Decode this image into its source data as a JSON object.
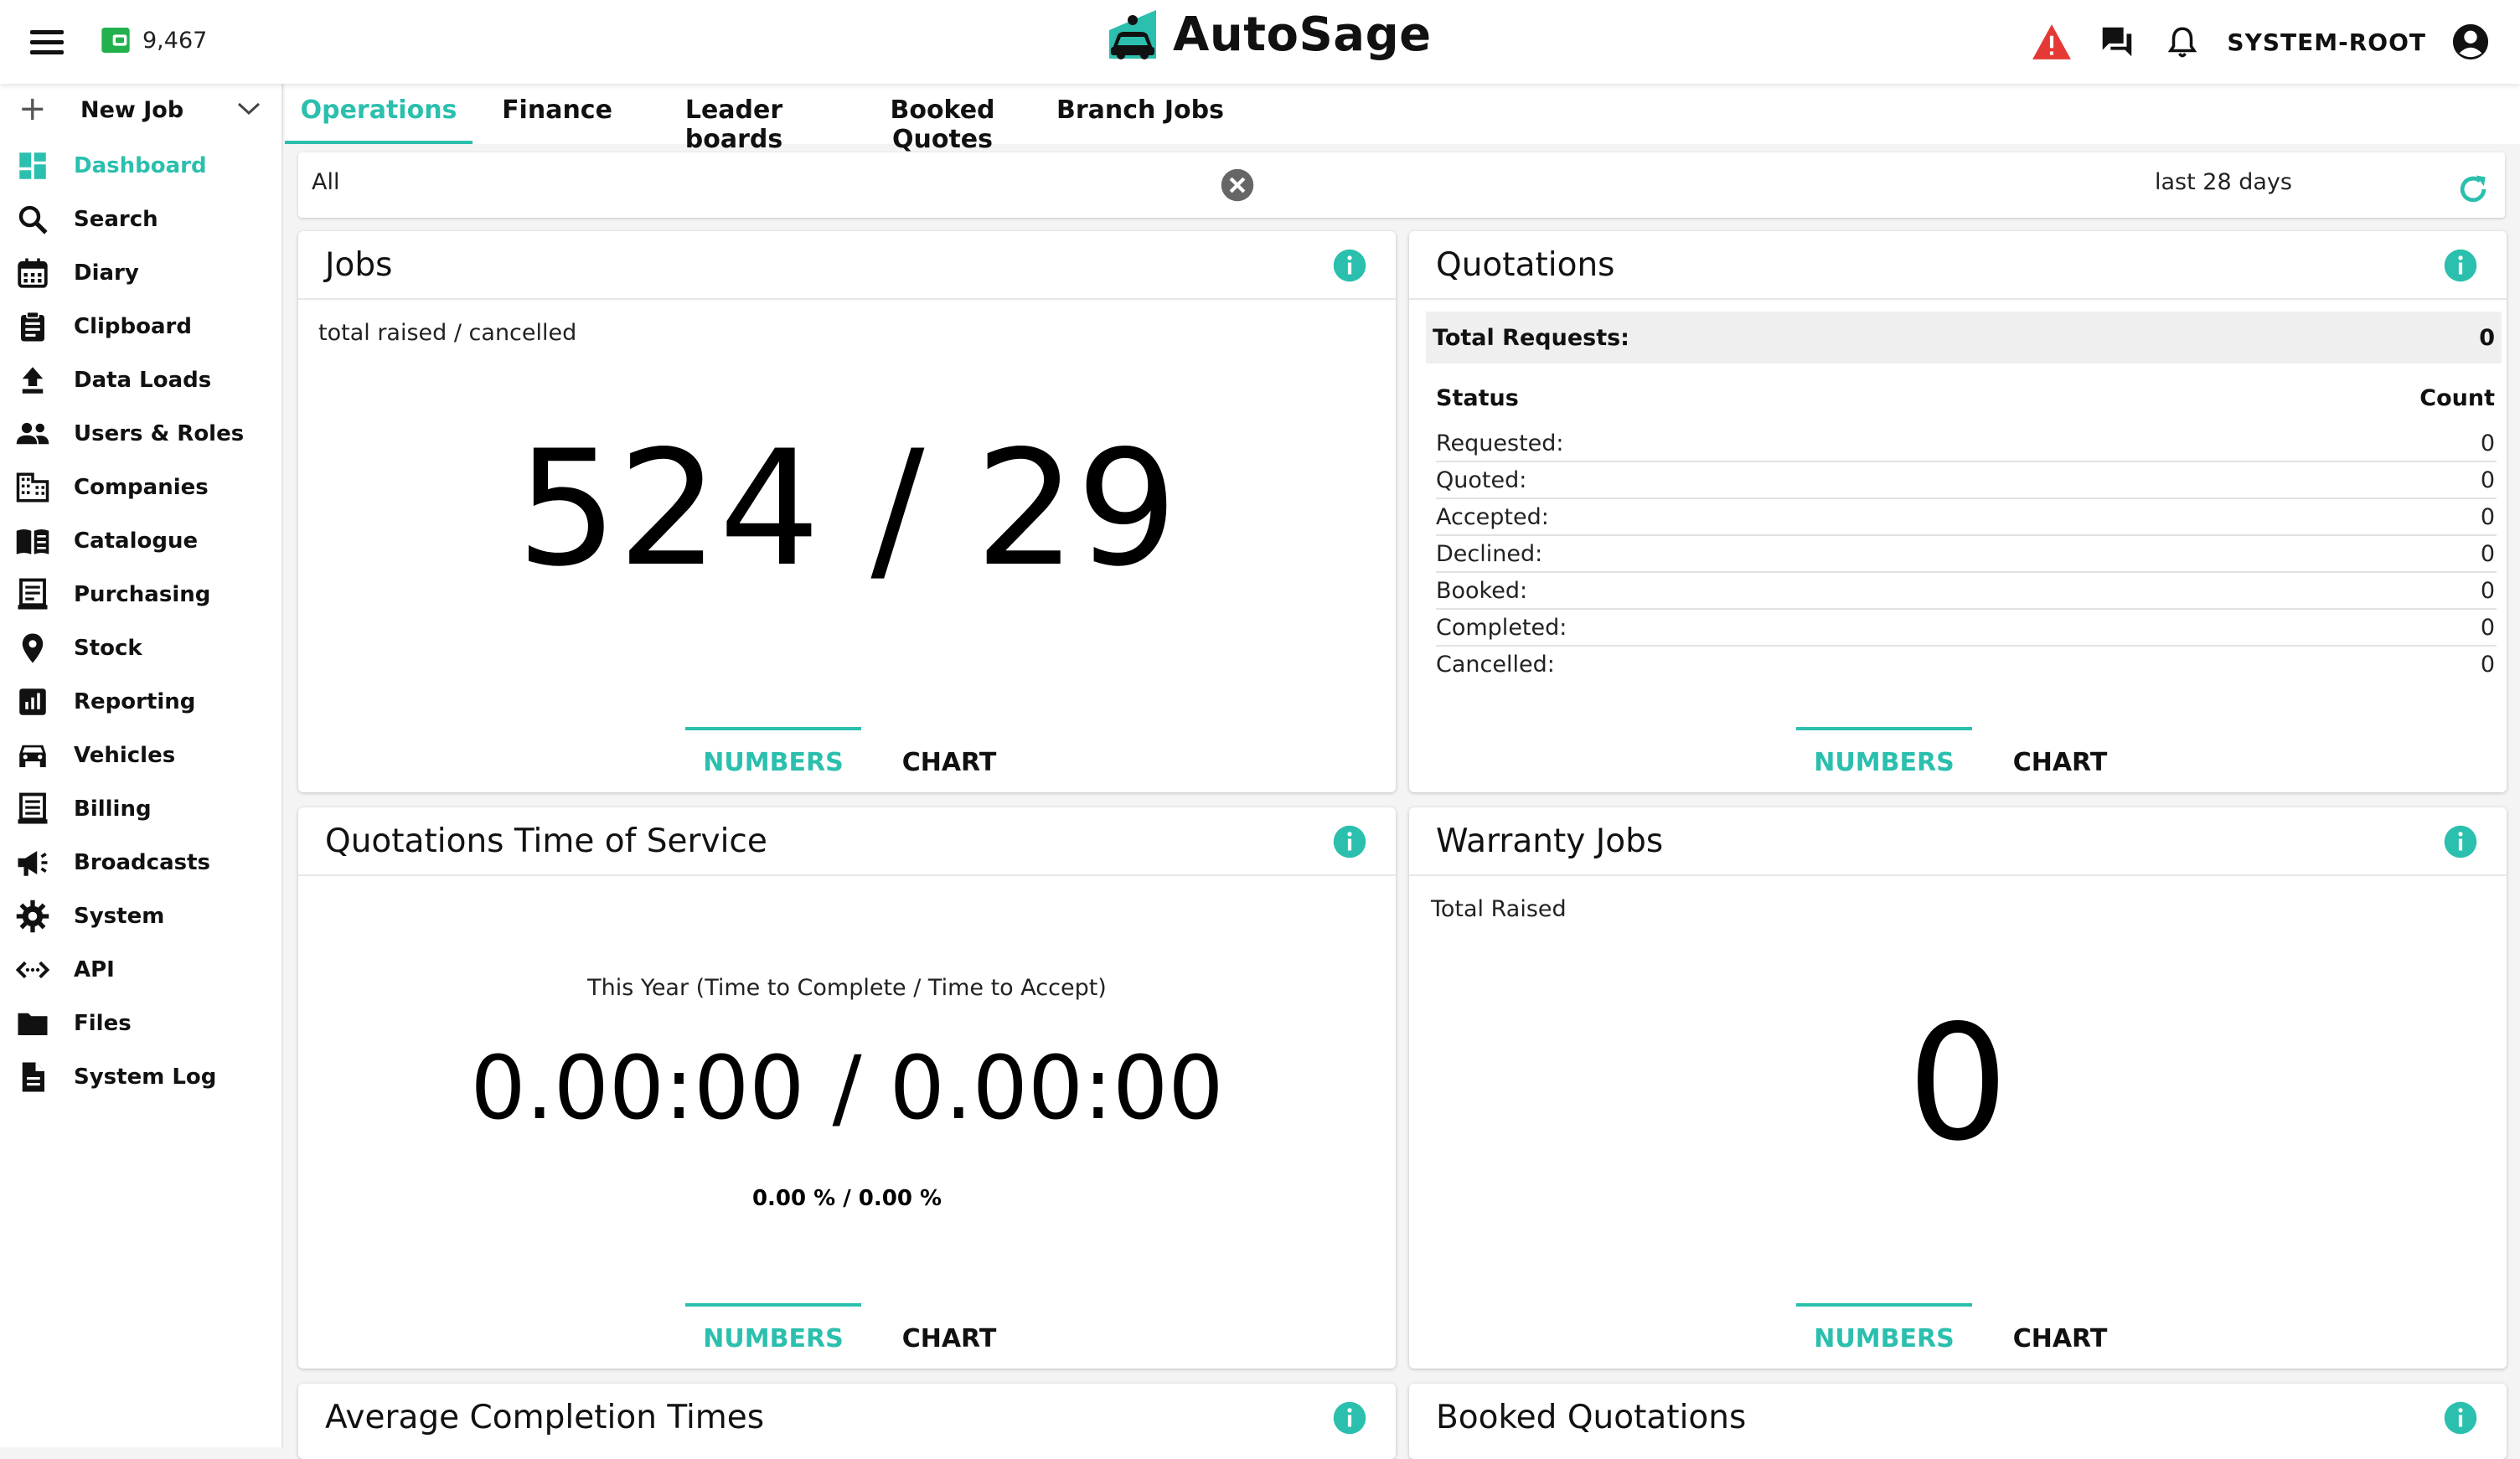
{
  "header": {
    "credits": "9,467",
    "brand": "AutoSage",
    "user": "SYSTEM-ROOT",
    "icons": [
      "menu-icon",
      "wallet-icon",
      "warning-icon",
      "chat-icon",
      "bell-icon",
      "account-circle-icon"
    ],
    "colors": {
      "accent": "#2bbfae",
      "warning": "#e53935",
      "wallet": "#22b14c"
    }
  },
  "sidebar": {
    "new_job": "New Job",
    "items": [
      {
        "label": "Dashboard",
        "icon": "dashboard-icon",
        "active": true
      },
      {
        "label": "Search",
        "icon": "search-icon"
      },
      {
        "label": "Diary",
        "icon": "calendar-icon"
      },
      {
        "label": "Clipboard",
        "icon": "clipboard-icon"
      },
      {
        "label": "Data Loads",
        "icon": "upload-icon"
      },
      {
        "label": "Users & Roles",
        "icon": "users-icon"
      },
      {
        "label": "Companies",
        "icon": "building-icon"
      },
      {
        "label": "Catalogue",
        "icon": "book-icon"
      },
      {
        "label": "Purchasing",
        "icon": "receipt-icon"
      },
      {
        "label": "Stock",
        "icon": "location-pin-icon"
      },
      {
        "label": "Reporting",
        "icon": "bar-chart-icon"
      },
      {
        "label": "Vehicles",
        "icon": "car-icon"
      },
      {
        "label": "Billing",
        "icon": "invoice-icon"
      },
      {
        "label": "Broadcasts",
        "icon": "megaphone-icon"
      },
      {
        "label": "System",
        "icon": "gear-icon"
      },
      {
        "label": "API",
        "icon": "code-icon"
      },
      {
        "label": "Files",
        "icon": "folder-icon"
      },
      {
        "label": "System Log",
        "icon": "document-icon"
      }
    ]
  },
  "tabs": [
    {
      "label": "Operations",
      "active": true
    },
    {
      "label": "Finance"
    },
    {
      "label": "Leader boards"
    },
    {
      "label": "Booked Quotes"
    },
    {
      "label": "Branch Jobs"
    }
  ],
  "filter": {
    "value": "All",
    "range": "last 28 days"
  },
  "cards": {
    "jobs": {
      "title": "Jobs",
      "subtitle": "total raised / cancelled",
      "value": "524 / 29",
      "numbers": "NUMBERS",
      "chart": "CHART"
    },
    "quotations": {
      "title": "Quotations",
      "total_label": "Total Requests:",
      "total_value": "0",
      "status_header": "Status",
      "count_header": "Count",
      "rows": [
        {
          "label": "Requested:",
          "count": "0"
        },
        {
          "label": "Quoted:",
          "count": "0"
        },
        {
          "label": "Accepted:",
          "count": "0"
        },
        {
          "label": "Declined:",
          "count": "0"
        },
        {
          "label": "Booked:",
          "count": "0"
        },
        {
          "label": "Completed:",
          "count": "0"
        },
        {
          "label": "Cancelled:",
          "count": "0"
        }
      ],
      "numbers": "NUMBERS",
      "chart": "CHART"
    },
    "time_of_service": {
      "title": "Quotations Time of Service",
      "caption": "This Year (Time to Complete / Time to Accept)",
      "value": "0.00:00 / 0.00:00",
      "percent": "0.00 % / 0.00 %",
      "numbers": "NUMBERS",
      "chart": "CHART"
    },
    "warranty": {
      "title": "Warranty Jobs",
      "subtitle": "Total Raised",
      "value": "0",
      "numbers": "NUMBERS",
      "chart": "CHART"
    },
    "avg_completion": {
      "title": "Average Completion Times"
    },
    "booked_quotations": {
      "title": "Booked Quotations"
    }
  }
}
